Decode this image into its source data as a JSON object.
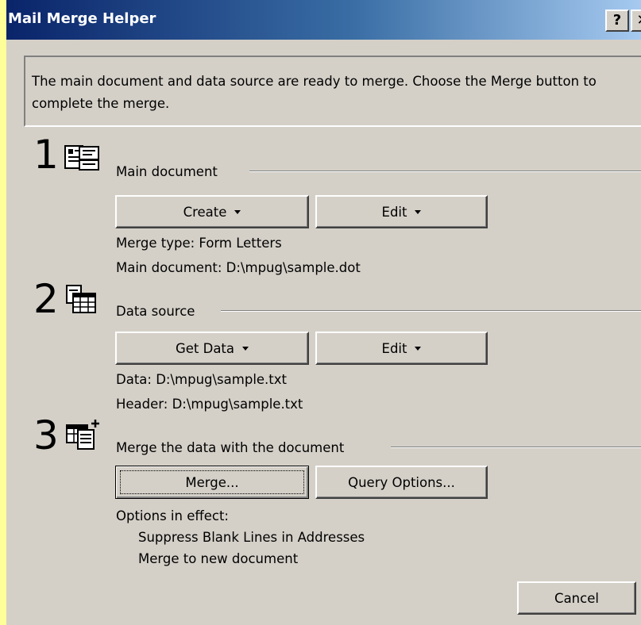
{
  "window": {
    "title": "Mail Merge Helper",
    "help_label": "?",
    "close_label": "✕"
  },
  "info_text": "The main document and data source are ready to merge. Choose the Merge button to complete the merge.",
  "step1": {
    "number": "1",
    "title": "Main document",
    "create_label": "Create",
    "edit_label": "Edit",
    "merge_type": "Merge type: Form Letters",
    "main_document": "Main document: D:\\mpug\\sample.dot"
  },
  "step2": {
    "number": "2",
    "title": "Data source",
    "get_data_label": "Get Data",
    "edit_label": "Edit",
    "data": "Data: D:\\mpug\\sample.txt",
    "header": "Header: D:\\mpug\\sample.txt"
  },
  "step3": {
    "number": "3",
    "title": "Merge the data with the document",
    "merge_label": "Merge...",
    "query_label": "Query Options...",
    "options_heading": "Options in effect:",
    "option1": "Suppress Blank Lines in Addresses",
    "option2": "Merge to new document"
  },
  "cancel_label": "Cancel"
}
